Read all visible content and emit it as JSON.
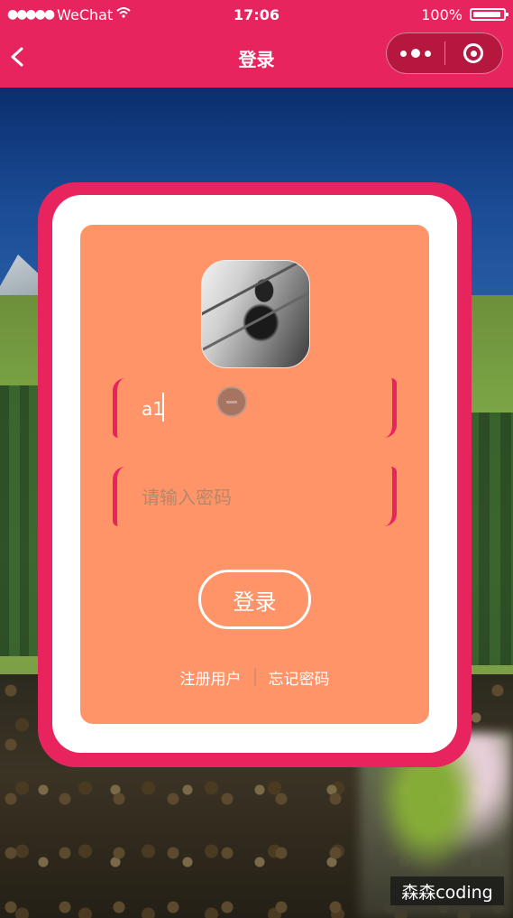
{
  "status_bar": {
    "signal": "●●●●●",
    "carrier": "WeChat",
    "time": "17:06",
    "battery": "100%"
  },
  "nav": {
    "title": "登录"
  },
  "form": {
    "username_value": "a1",
    "password_placeholder": "请输入密码",
    "login_label": "登录",
    "register_link": "注册用户",
    "forgot_link": "忘记密码"
  },
  "watermark": "森森coding",
  "colors": {
    "brand": "#e8245e",
    "panel": "#ff9468",
    "card": "#ffffff"
  },
  "icons": [
    "back-icon",
    "wifi-icon",
    "battery-icon",
    "menu-dots-icon",
    "close-target-icon"
  ]
}
